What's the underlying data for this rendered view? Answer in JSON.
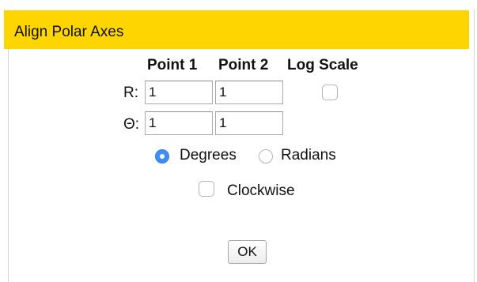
{
  "dialog": {
    "title": "Align Polar Axes"
  },
  "columns": {
    "point1": "Point 1",
    "point2": "Point 2",
    "log_scale": "Log Scale"
  },
  "rows": {
    "r_label": "R:",
    "r_point1": "1",
    "r_point2": "1",
    "r_log_scale_checked": false,
    "theta_label": "Θ:",
    "theta_point1": "1",
    "theta_point2": "1"
  },
  "units": {
    "selected": "Degrees",
    "degrees_label": "Degrees",
    "radians_label": "Radians"
  },
  "clockwise": {
    "label": "Clockwise",
    "checked": false
  },
  "ok_label": "OK",
  "colors": {
    "title_bar": "#ffd500",
    "radio_selected": "#3b8ff5"
  }
}
